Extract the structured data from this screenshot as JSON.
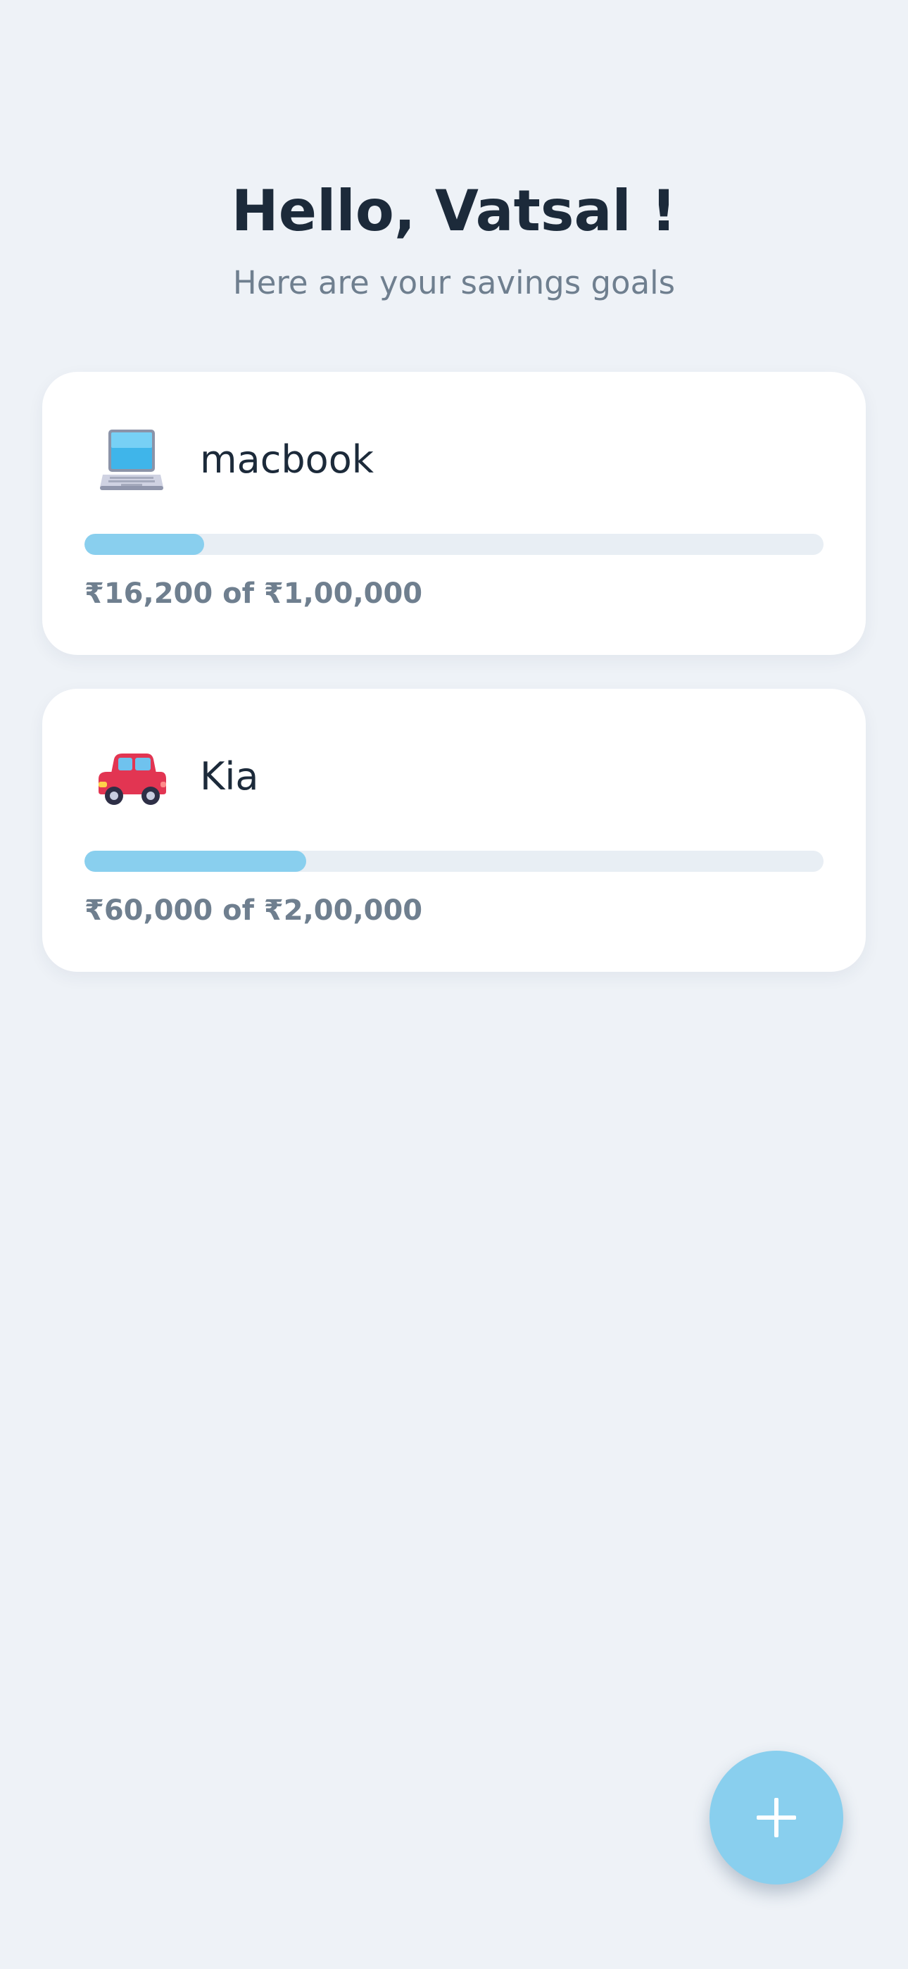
{
  "header": {
    "greeting": "Hello, Vatsal !",
    "subtitle": "Here are your savings goals"
  },
  "goals": [
    {
      "name": "macbook",
      "icon": "laptop-icon",
      "amount_text": "₹16,200 of ₹1,00,000",
      "saved": 16200,
      "target": 100000,
      "progress": 0.162
    },
    {
      "name": "Kia",
      "icon": "car-icon",
      "amount_text": "₹60,000 of ₹2,00,000",
      "saved": 60000,
      "target": 200000,
      "progress": 0.3
    }
  ],
  "fab": {
    "icon": "plus-icon"
  },
  "colors": {
    "background": "#eef2f7",
    "card": "#ffffff",
    "accent": "#89cfee",
    "track": "#e8eef4",
    "title": "#1c2a3a",
    "muted": "#6f7f8f"
  }
}
